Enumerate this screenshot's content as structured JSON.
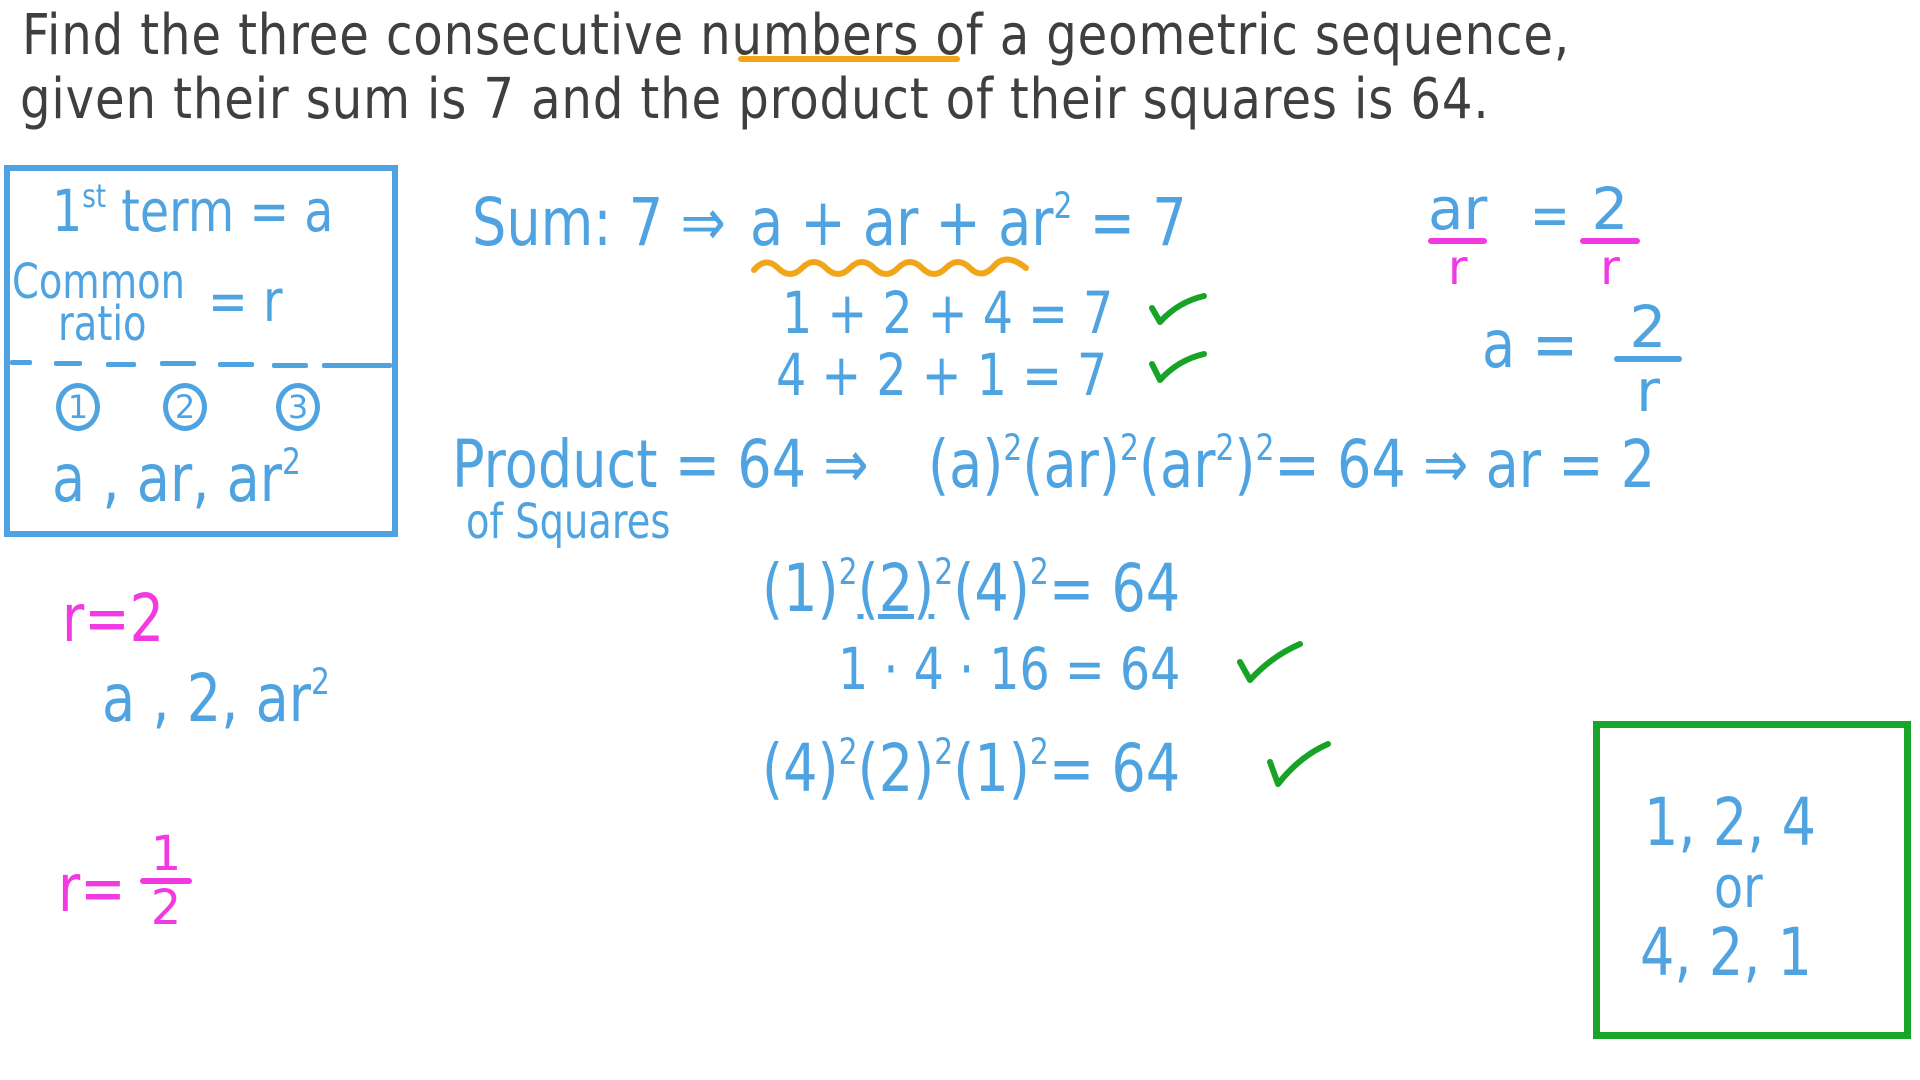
{
  "problem": {
    "line1_before": "Find the three consecutive ",
    "line1_highlight": "numbers",
    "line1_after": " of a geometric sequence,",
    "line2": "given their sum is 7 and the product of their squares is 64."
  },
  "definitions_box": {
    "first_term_label": "1",
    "first_term_sup": "st",
    "first_term_rest": " term = a",
    "common_label_1": "Common",
    "common_label_2": "ratio",
    "common_value": "= r",
    "term_numbers": [
      "1",
      "2",
      "3"
    ],
    "terms": "a , ar, ar",
    "terms_sup": "2"
  },
  "sum_section": {
    "lhs": "Sum: 7 ⇒",
    "equation": "a + ar + ar",
    "equation_sup": "2",
    "equation_rhs": " = 7",
    "check1": "1 + 2 + 4 = 7",
    "check2": "4 + 2 + 1 = 7"
  },
  "product_section": {
    "label_line1": "Product = 64 ⇒",
    "label_line2": "of Squares",
    "eq_part1": "(a)",
    "eq_part2": "(ar)",
    "eq_part3": "(ar",
    "eq_part3_inner_sup": "2",
    "eq_part3_close": ")",
    "eq_rhs": "= 64 ⇒ ar = 2",
    "sup": "2",
    "check1_terms": [
      "(1)",
      "(2)",
      "(4)"
    ],
    "check1_rhs": "= 64",
    "check1_expanded": "1 · 4 · 16 = 64",
    "check2_terms": [
      "(4)",
      "(2)",
      "(1)"
    ],
    "check2_rhs": "= 64"
  },
  "solve_for_a": {
    "lhs_num": "ar",
    "lhs_den": "r",
    "equals": "=",
    "rhs_num": "2",
    "rhs_den": "r",
    "result_lhs": "a =",
    "result_num": "2",
    "result_den": "r"
  },
  "ratio_cases": {
    "case1": "r=2",
    "case1_terms": "a , 2, ar",
    "case1_terms_sup": "2",
    "case2_lhs": "r=",
    "case2_num": "1",
    "case2_den": "2"
  },
  "answer_box": {
    "line1": "1, 2, 4",
    "line2": "or",
    "line3": "4, 2, 1"
  },
  "colors": {
    "text_dark": "#3f3f3f",
    "blue": "#4fa3e0",
    "pink": "#f23ae3",
    "green": "#17a325",
    "orange": "#f2a516"
  }
}
